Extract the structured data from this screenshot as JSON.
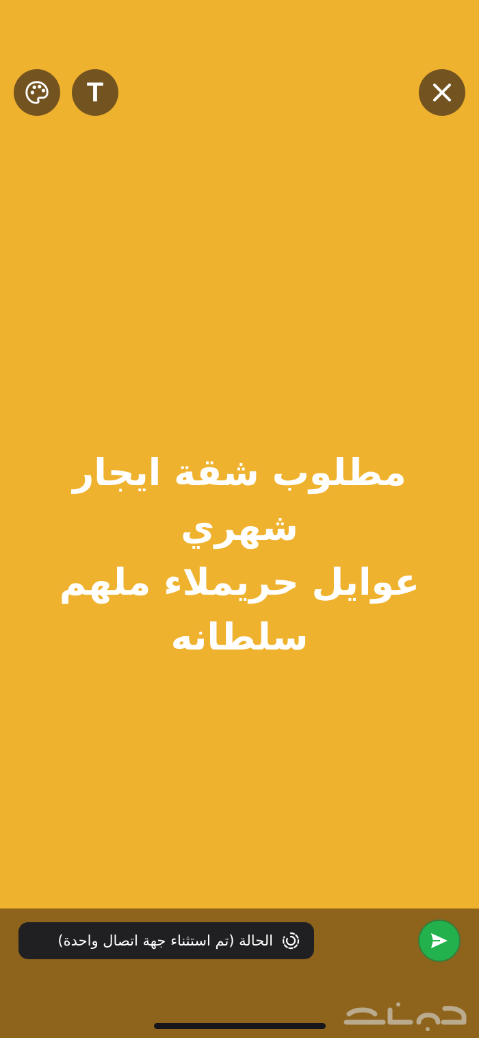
{
  "toolbar": {
    "palette_icon": "palette-icon",
    "text_button_label": "T",
    "close_icon": "close-icon"
  },
  "status": {
    "lines": [
      "مطلوب شقة ايجار شهري",
      "عوايل حريملاء ملهم",
      "سلطانه"
    ],
    "background_color": "#EFB22E",
    "text_color": "#FFFFFF"
  },
  "composer": {
    "privacy_label": "الحالة (تم استثناء جهة اتصال واحدة)",
    "privacy_icon": "status-ring-icon",
    "send_icon": "send-icon",
    "send_color": "#22B14C"
  },
  "watermark": {
    "text": "حراج"
  }
}
